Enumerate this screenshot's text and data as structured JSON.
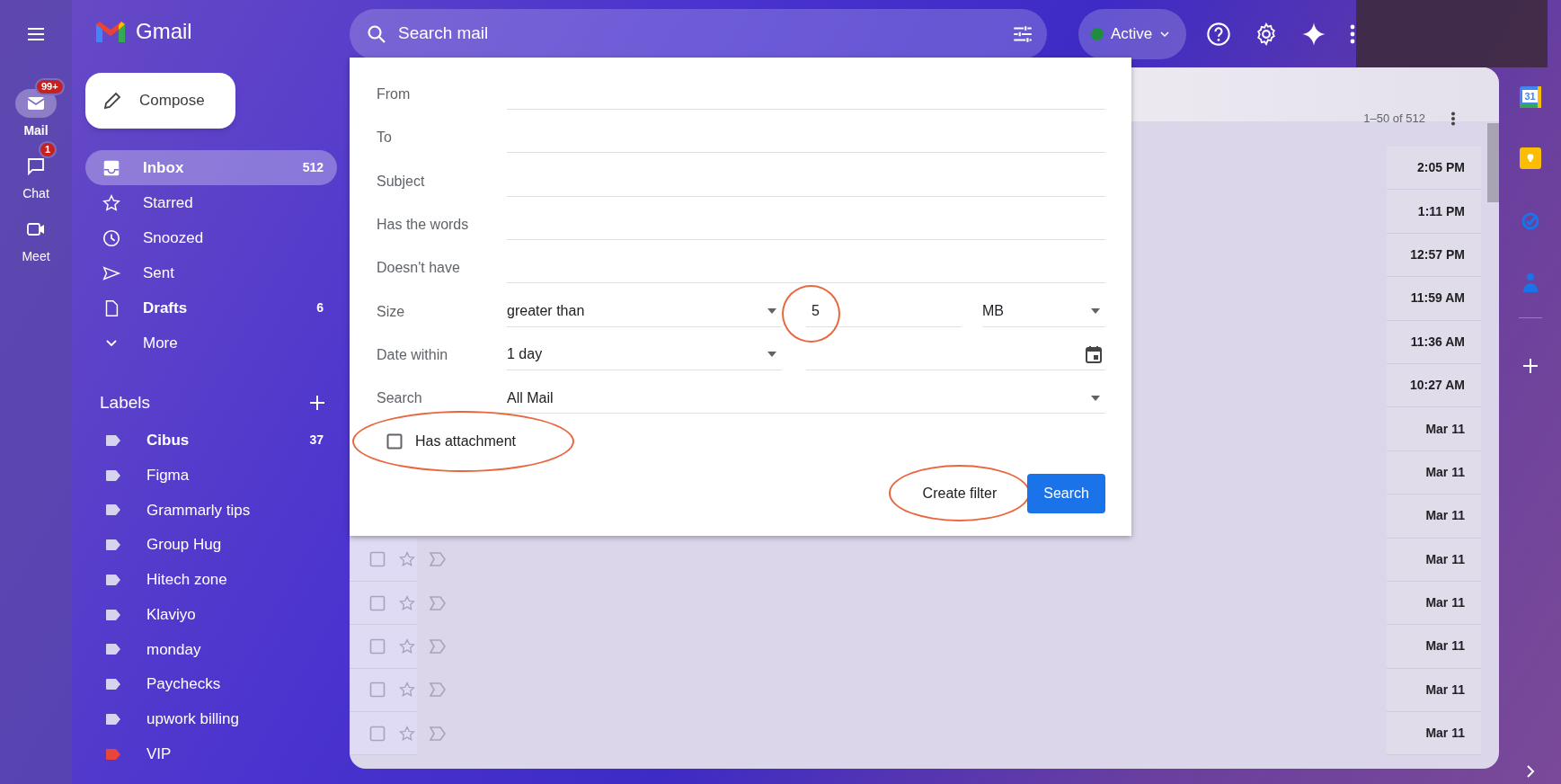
{
  "rail": {
    "items": [
      {
        "label": "Mail",
        "badge": "99+",
        "selected": true
      },
      {
        "label": "Chat",
        "badge": "1",
        "selected": false
      },
      {
        "label": "Meet",
        "selected": false
      }
    ]
  },
  "brand": {
    "name": "Gmail"
  },
  "compose": {
    "label": "Compose"
  },
  "nav": [
    {
      "label": "Inbox",
      "count": "512",
      "bold": true,
      "selected": true
    },
    {
      "label": "Starred",
      "bold": false,
      "selected": false
    },
    {
      "label": "Snoozed",
      "bold": false,
      "selected": false
    },
    {
      "label": "Sent",
      "bold": false,
      "selected": false
    },
    {
      "label": "Drafts",
      "count": "6",
      "bold": true,
      "selected": false
    },
    {
      "label": "More",
      "bold": false,
      "selected": false
    }
  ],
  "labels": {
    "title": "Labels",
    "items": [
      {
        "name": "Cibus",
        "count": "37",
        "bold": true,
        "color": "#d6d3ee"
      },
      {
        "name": "Figma",
        "bold": false,
        "color": "#d6d3ee"
      },
      {
        "name": "Grammarly tips",
        "bold": false,
        "color": "#d6d3ee"
      },
      {
        "name": "Group Hug",
        "bold": false,
        "color": "#d6d3ee"
      },
      {
        "name": "Hitech zone",
        "bold": false,
        "color": "#d6d3ee"
      },
      {
        "name": "Klaviyo",
        "bold": false,
        "color": "#d6d3ee"
      },
      {
        "name": "monday",
        "bold": false,
        "color": "#d6d3ee"
      },
      {
        "name": "Paychecks",
        "bold": false,
        "color": "#d6d3ee"
      },
      {
        "name": "upwork billing",
        "bold": false,
        "color": "#d6d3ee"
      },
      {
        "name": "VIP",
        "bold": false,
        "color": "#e8453c"
      }
    ]
  },
  "search": {
    "placeholder": "Search mail"
  },
  "status": {
    "label": "Active",
    "color": "#1e8e3e"
  },
  "search_options": {
    "rows": [
      {
        "kind": "text",
        "label": "From"
      },
      {
        "kind": "text",
        "label": "To"
      },
      {
        "kind": "text",
        "label": "Subject"
      },
      {
        "kind": "text",
        "label": "Has the words"
      },
      {
        "kind": "text",
        "label": "Doesn't have"
      },
      {
        "kind": "size",
        "label": "Size",
        "operator": "greater than",
        "value": "5",
        "unit": "MB",
        "value_highlighted": true
      },
      {
        "kind": "date",
        "label": "Date within",
        "value": "1 day"
      },
      {
        "kind": "select",
        "label": "Search",
        "value": "All Mail"
      }
    ],
    "has_attachment": {
      "label": "Has attachment",
      "checked": false,
      "highlighted": true
    },
    "buttons": [
      {
        "kind": "text",
        "label": "Create filter",
        "highlighted": true
      },
      {
        "kind": "primary",
        "label": "Search",
        "highlighted": false
      }
    ]
  },
  "pager": {
    "range": "1–50 of 512"
  },
  "messages": [
    {
      "time": "2:05 PM"
    },
    {
      "time": "1:11 PM"
    },
    {
      "time": "12:57 PM"
    },
    {
      "time": "11:59 AM"
    },
    {
      "time": "11:36 AM"
    },
    {
      "time": "10:27 AM"
    },
    {
      "time": "Mar 11"
    },
    {
      "time": "Mar 11"
    },
    {
      "time": "Mar 11"
    },
    {
      "time": "Mar 11",
      "checked": false,
      "starred": false
    },
    {
      "time": "Mar 11",
      "checked": false,
      "starred": false
    },
    {
      "time": "Mar 11",
      "checked": false,
      "starred": false
    },
    {
      "time": "Mar 11",
      "checked": false,
      "starred": false
    },
    {
      "time": "Mar 11",
      "checked": false,
      "starred": false
    }
  ],
  "side_panel": {
    "calendar_day": "31"
  }
}
